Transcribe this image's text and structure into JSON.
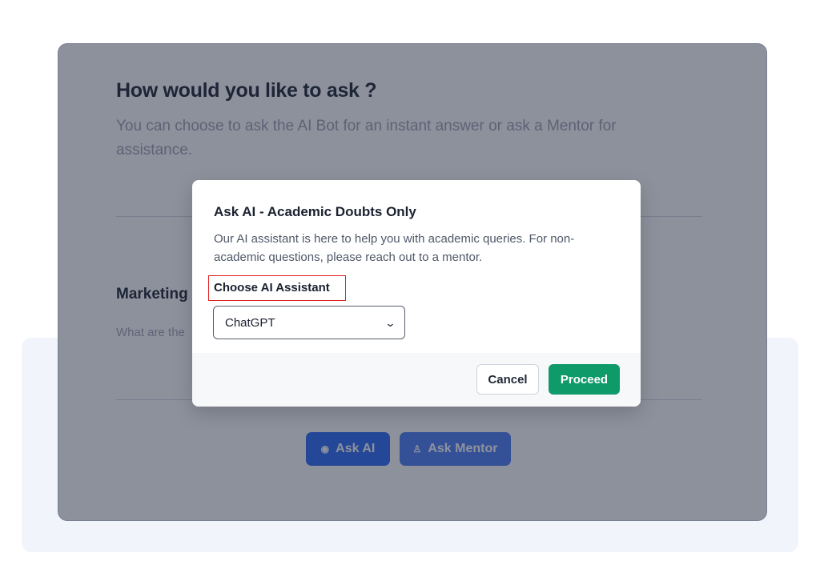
{
  "page": {
    "title": "How would you like to ask ?",
    "subtitle": "You can choose to ask the AI Bot for an instant answer or ask a Mentor for assistance.",
    "question_title": "Marketing",
    "question_text": "What are the",
    "actions": {
      "ask_ai_label": "Ask AI",
      "ask_ai_icon": "robot-icon",
      "ask_mentor_label": "Ask Mentor",
      "ask_mentor_icon": "user-icon"
    }
  },
  "modal": {
    "title": "Ask AI - Academic Doubts Only",
    "description": "Our AI assistant is here to help you with academic queries. For non-academic questions, please reach out to a mentor.",
    "field_label": "Choose AI Assistant",
    "select": {
      "value": "ChatGPT",
      "icon": "chevron-down-icon"
    },
    "cancel_label": "Cancel",
    "proceed_label": "Proceed"
  },
  "colors": {
    "primary": "#2f6bf5",
    "proceed": "#0f9a6a",
    "highlight": "#e02020",
    "overlay": "#1b233a"
  }
}
